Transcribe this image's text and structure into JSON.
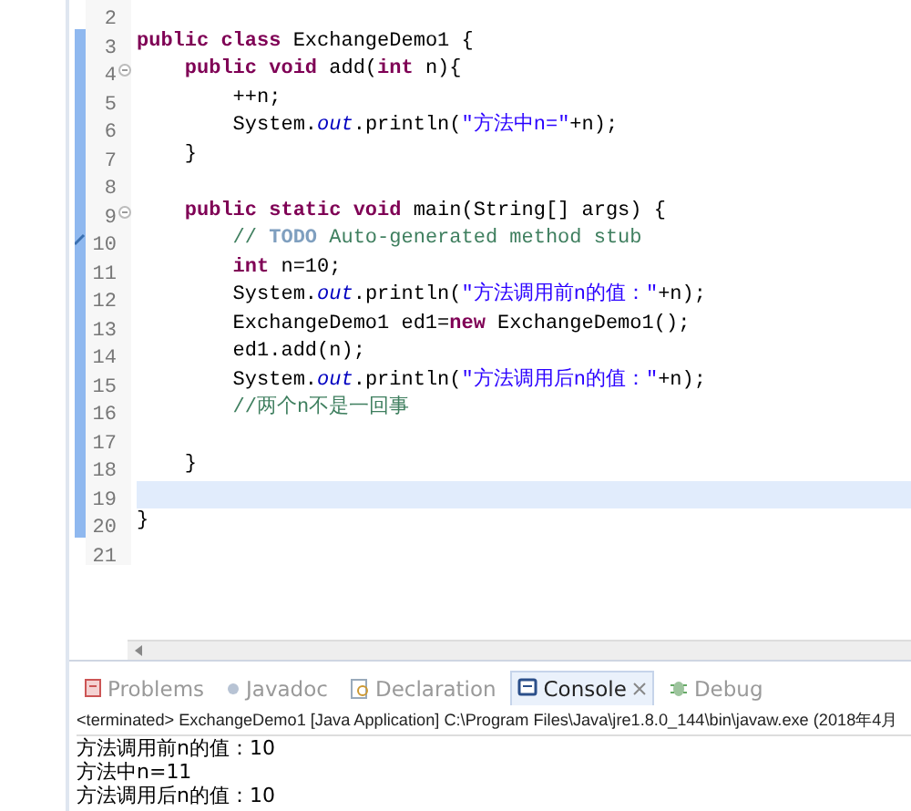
{
  "editor": {
    "lines": [
      {
        "number": "2",
        "changed": false,
        "collapsible": false,
        "task": false,
        "current": false
      },
      {
        "number": "3",
        "changed": true,
        "collapsible": false,
        "task": false,
        "current": false,
        "tokens": [
          {
            "kind": "keyword",
            "text": "public class "
          },
          {
            "kind": "plain",
            "text": "ExchangeDemo1 {"
          }
        ]
      },
      {
        "number": "4",
        "changed": true,
        "collapsible": true,
        "task": false,
        "current": false,
        "tokens": [
          {
            "kind": "keyword",
            "text": "    public void "
          },
          {
            "kind": "plain",
            "text": "add("
          },
          {
            "kind": "keyword",
            "text": "int "
          },
          {
            "kind": "plain",
            "text": "n){"
          }
        ]
      },
      {
        "number": "5",
        "changed": true,
        "collapsible": false,
        "task": false,
        "current": false,
        "tokens": [
          {
            "kind": "plain",
            "text": "        ++n;"
          }
        ]
      },
      {
        "number": "6",
        "changed": true,
        "collapsible": false,
        "task": false,
        "current": false,
        "tokens": [
          {
            "kind": "plain",
            "text": "        System."
          },
          {
            "kind": "field",
            "text": "out"
          },
          {
            "kind": "plain",
            "text": ".println("
          },
          {
            "kind": "string",
            "text": "\"方法中n=\""
          },
          {
            "kind": "plain",
            "text": "+n);"
          }
        ]
      },
      {
        "number": "7",
        "changed": true,
        "collapsible": false,
        "task": false,
        "current": false,
        "tokens": [
          {
            "kind": "plain",
            "text": "    }"
          }
        ]
      },
      {
        "number": "8",
        "changed": true,
        "collapsible": false,
        "task": false,
        "current": false
      },
      {
        "number": "9",
        "changed": true,
        "collapsible": true,
        "task": false,
        "current": false,
        "tokens": [
          {
            "kind": "keyword",
            "text": "    public static void "
          },
          {
            "kind": "plain",
            "text": "main(String[] args) {"
          }
        ]
      },
      {
        "number": "10",
        "changed": true,
        "collapsible": false,
        "task": true,
        "current": false,
        "tokens": [
          {
            "kind": "comment",
            "text": "        // "
          },
          {
            "kind": "todo",
            "text": "TODO"
          },
          {
            "kind": "comment",
            "text": " Auto-generated method stub"
          }
        ]
      },
      {
        "number": "11",
        "changed": true,
        "collapsible": false,
        "task": false,
        "current": false,
        "tokens": [
          {
            "kind": "keyword",
            "text": "        int "
          },
          {
            "kind": "plain",
            "text": "n=10;"
          }
        ]
      },
      {
        "number": "12",
        "changed": true,
        "collapsible": false,
        "task": false,
        "current": false,
        "tokens": [
          {
            "kind": "plain",
            "text": "        System."
          },
          {
            "kind": "field",
            "text": "out"
          },
          {
            "kind": "plain",
            "text": ".println("
          },
          {
            "kind": "string",
            "text": "\"方法调用前n的值：\""
          },
          {
            "kind": "plain",
            "text": "+n);"
          }
        ]
      },
      {
        "number": "13",
        "changed": true,
        "collapsible": false,
        "task": false,
        "current": false,
        "tokens": [
          {
            "kind": "plain",
            "text": "        ExchangeDemo1 ed1="
          },
          {
            "kind": "keyword",
            "text": "new "
          },
          {
            "kind": "plain",
            "text": "ExchangeDemo1();"
          }
        ]
      },
      {
        "number": "14",
        "changed": true,
        "collapsible": false,
        "task": false,
        "current": false,
        "tokens": [
          {
            "kind": "plain",
            "text": "        ed1.add(n);"
          }
        ]
      },
      {
        "number": "15",
        "changed": true,
        "collapsible": false,
        "task": false,
        "current": false,
        "tokens": [
          {
            "kind": "plain",
            "text": "        System."
          },
          {
            "kind": "field",
            "text": "out"
          },
          {
            "kind": "plain",
            "text": ".println("
          },
          {
            "kind": "string",
            "text": "\"方法调用后n的值：\""
          },
          {
            "kind": "plain",
            "text": "+n);"
          }
        ]
      },
      {
        "number": "16",
        "changed": true,
        "collapsible": false,
        "task": false,
        "current": false,
        "tokens": [
          {
            "kind": "comment",
            "text": "        //两个n不是一回事"
          }
        ]
      },
      {
        "number": "17",
        "changed": true,
        "collapsible": false,
        "task": false,
        "current": false
      },
      {
        "number": "18",
        "changed": true,
        "collapsible": false,
        "task": false,
        "current": false,
        "tokens": [
          {
            "kind": "plain",
            "text": "    }"
          }
        ]
      },
      {
        "number": "19",
        "changed": true,
        "collapsible": false,
        "task": false,
        "current": true
      },
      {
        "number": "20",
        "changed": true,
        "collapsible": false,
        "task": false,
        "current": false,
        "tokens": [
          {
            "kind": "plain",
            "text": "}"
          }
        ]
      },
      {
        "number": "21",
        "changed": false,
        "collapsible": false,
        "task": false,
        "current": false
      }
    ]
  },
  "panel": {
    "tabs": [
      {
        "label": "Problems",
        "kind": "problems",
        "selected": false
      },
      {
        "label": "Javadoc",
        "kind": "javadoc",
        "selected": false
      },
      {
        "label": "Declaration",
        "kind": "declaration",
        "selected": false
      },
      {
        "label": "Console",
        "kind": "console",
        "selected": true
      },
      {
        "label": "Debug",
        "kind": "debug",
        "selected": false
      }
    ],
    "status": "<terminated> ExchangeDemo1 [Java Application] C:\\Program Files\\Java\\jre1.8.0_144\\bin\\javaw.exe (2018年4月",
    "output": [
      "方法调用前n的值：10",
      "方法中n=11",
      "方法调用后n的值：10"
    ]
  }
}
